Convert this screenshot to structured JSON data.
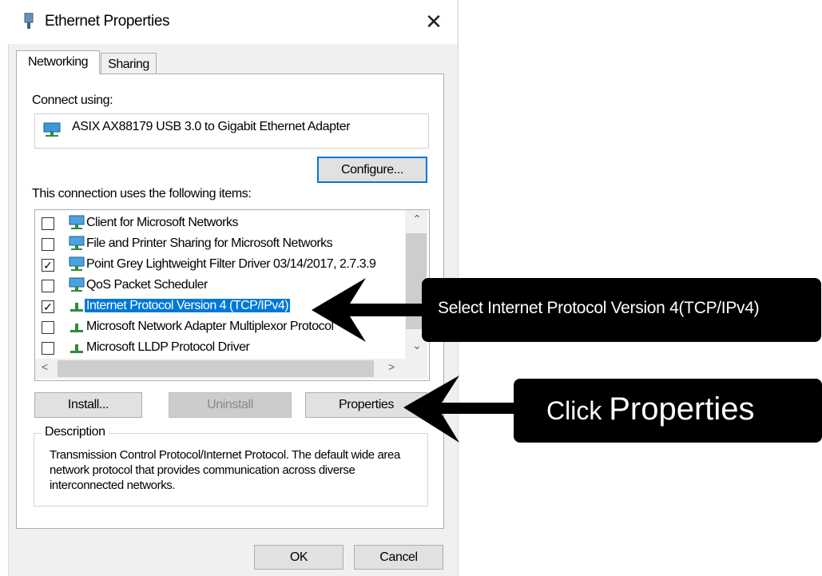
{
  "window": {
    "title": "Ethernet Properties",
    "close_symbol": "✕"
  },
  "tabs": [
    {
      "label": "Networking",
      "active": true
    },
    {
      "label": "Sharing",
      "active": false
    }
  ],
  "connect_using": {
    "label": "Connect using:",
    "adapter": "ASIX AX88179 USB 3.0 to Gigabit Ethernet Adapter",
    "icon": "network-adapter-icon"
  },
  "configure_label": "Configure...",
  "items_label": "This connection uses the following items:",
  "items": [
    {
      "label": "Client for Microsoft Networks",
      "checked": false,
      "icon": "network-client-icon"
    },
    {
      "label": "File and Printer Sharing for Microsoft Networks",
      "checked": false,
      "icon": "network-service-icon"
    },
    {
      "label": "Point Grey Lightweight Filter Driver 03/14/2017, 2.7.3.9",
      "checked": true,
      "icon": "network-service-icon"
    },
    {
      "label": "QoS Packet Scheduler",
      "checked": false,
      "icon": "network-service-icon"
    },
    {
      "label": "Internet Protocol Version 4 (TCP/IPv4)",
      "checked": true,
      "selected": true,
      "icon": "protocol-icon"
    },
    {
      "label": "Microsoft Network Adapter Multiplexor Protocol",
      "checked": false,
      "icon": "protocol-icon"
    },
    {
      "label": "Microsoft LLDP Protocol Driver",
      "checked": false,
      "icon": "protocol-icon"
    }
  ],
  "buttons": {
    "install": "Install...",
    "uninstall": "Uninstall",
    "properties": "Properties",
    "ok": "OK",
    "cancel": "Cancel"
  },
  "description": {
    "legend": "Description",
    "text": "Transmission Control Protocol/Internet Protocol. The default wide area network protocol that provides communication across diverse interconnected networks."
  },
  "callouts": {
    "select": "Select Internet Protocol Version 4(TCP/IPv4)",
    "click_prefix": "Click ",
    "click_target": "Properties"
  },
  "colors": {
    "selection": "#0078d7",
    "callout_bg": "#000000",
    "callout_text": "#ffffff"
  }
}
